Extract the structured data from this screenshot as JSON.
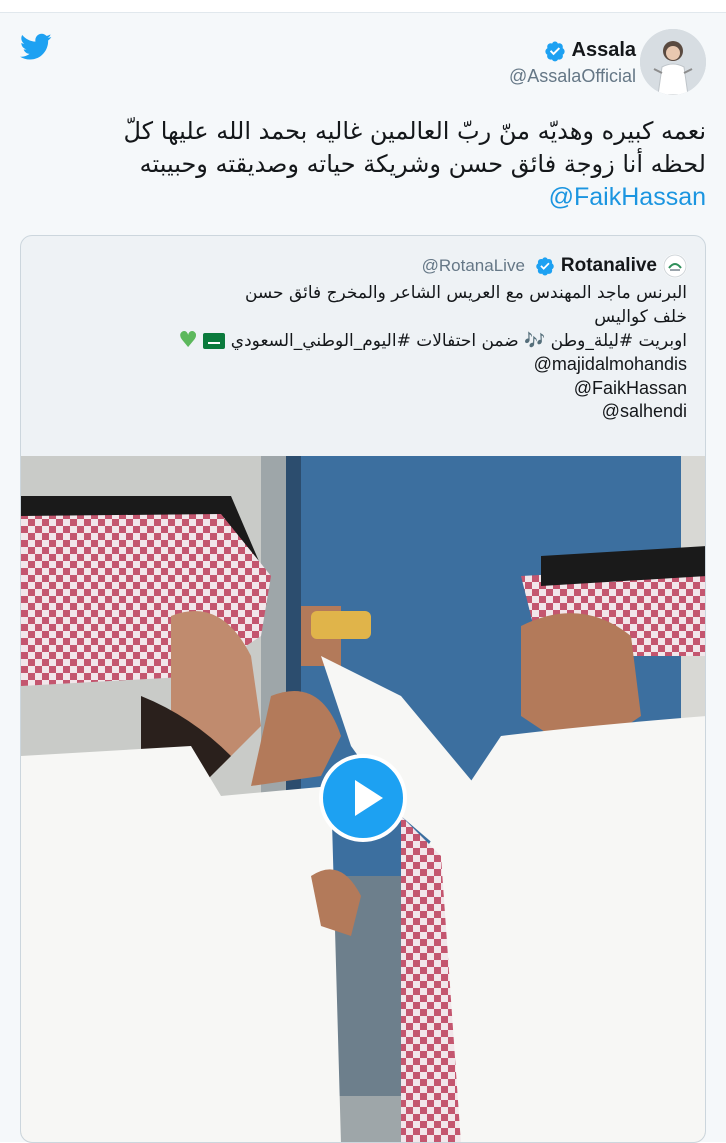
{
  "tweet": {
    "author_name": "Assala",
    "author_handle": "@AssalaOfficial",
    "text_lines": [
      "نعمه كبيره وهديّه منّ ربّ العالمين غاليه بحمد الله عليها كلّ",
      "لحظه أنا زوجة فائق حسن وشريكة حياته وصديقته وحبيبته"
    ],
    "mention": "@FaikHassan"
  },
  "quote": {
    "author_name": "Rotanalive",
    "author_handle": "@RotanaLive",
    "line1": "البرنس ماجد المهندس مع العريس الشاعر والمخرج فائق حسن",
    "line2": "خلف كواليس",
    "line3": "اوبريت #ليلة_وطن 🎶 ضمن احتفالات #اليوم_الوطني_السعودي",
    "mentions": [
      "@majidalmohandis",
      "@FaikHassan",
      "@salhendi"
    ]
  },
  "colors": {
    "twitter_blue": "#1da1f2",
    "link": "#1b95e0",
    "verified": "#1da1f2",
    "heart": "#5cb85c"
  },
  "icons": [
    "twitter-bird-icon",
    "verified-badge-icon",
    "play-icon",
    "saudi-flag-emoji",
    "green-heart-emoji",
    "music-notes-emoji"
  ]
}
